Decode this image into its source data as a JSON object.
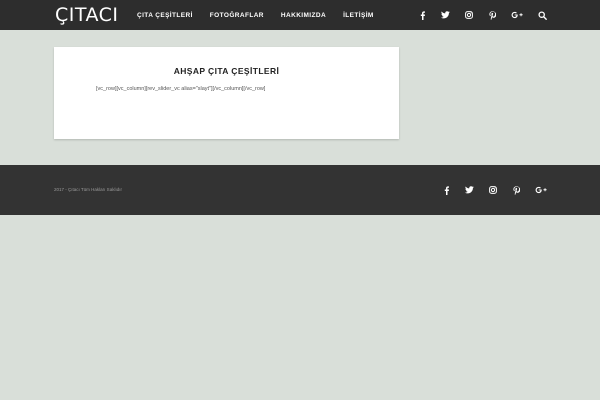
{
  "header": {
    "logo": "ÇITACI",
    "nav": [
      "ÇITA ÇEŞİTLERİ",
      "FOTOĞRAFLAR",
      "HAKKIMIZDA",
      "İLETİŞİM"
    ],
    "social_icons": [
      "facebook-icon",
      "twitter-icon",
      "instagram-icon",
      "pinterest-icon",
      "google-plus-icon"
    ],
    "search_icon": "search-icon"
  },
  "content": {
    "title": "AHŞAP ÇITA ÇEŞİTLERİ",
    "shortcode": "[vc_row][vc_column][rev_slider_vc alias=\"slayt\"][/vc_column][/vc_row]"
  },
  "footer": {
    "copyright": "2017 - Çıtacı Tüm Hakları Saklıdır",
    "social_icons": [
      "facebook-icon",
      "twitter-icon",
      "instagram-icon",
      "pinterest-icon",
      "google-plus-icon"
    ]
  },
  "colors": {
    "background": "#d9dfd9",
    "header": "#2d2d2d",
    "footer": "#333333",
    "card": "#ffffff"
  }
}
